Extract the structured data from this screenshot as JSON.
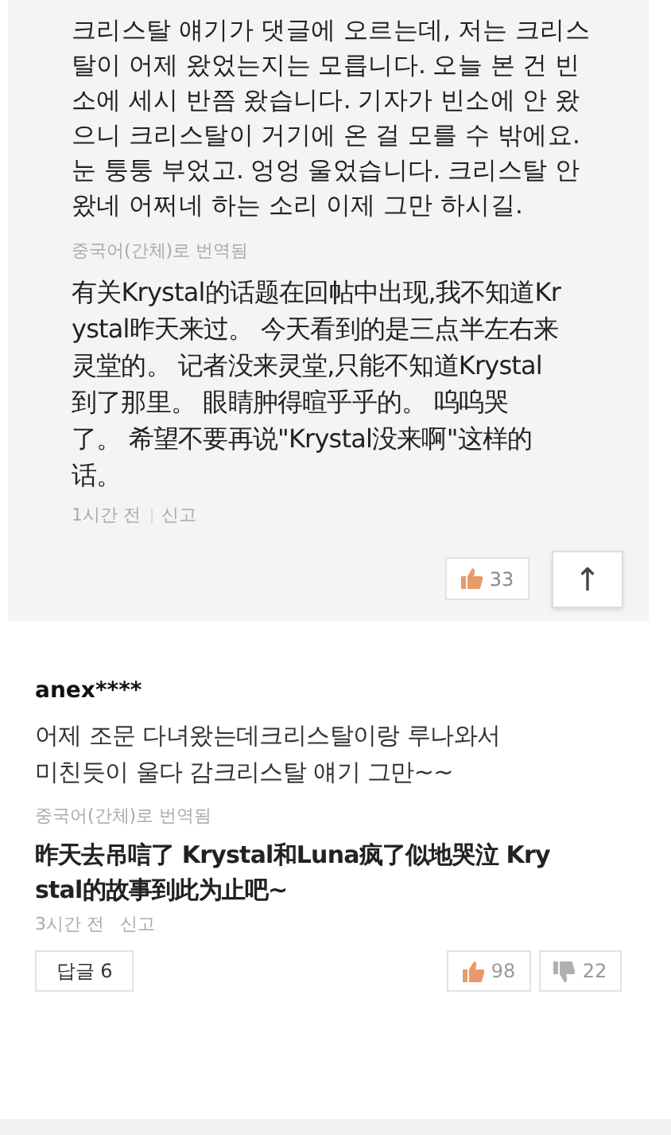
{
  "comments": [
    {
      "original_lines": [
        "크리스탈 얘기가 댓글에 오르는데, 저는 크리스",
        "탈이 어제 왔었는지는 모릅니다. 오늘 본 건 빈",
        "소에 세시 반쯤 왔습니다. 기자가 빈소에 안 왔",
        "으니 크리스탈이 거기에 온 걸 모를 수 밖에요.",
        "눈 퉁퉁 부었고. 엉엉 울었습니다. 크리스탈 안",
        "왔네 어쩌네 하는 소리 이제 그만 하시길."
      ],
      "translation_note": "중국어(간체)로 번역됨",
      "translation_lines": [
        "有关Krystal的话题在回帖中出现,我不知道Kr",
        "ystal昨天来过。 今天看到的是三点半左右来",
        "灵堂的。 记者没来灵堂,只能不知道Krystal",
        "到了那里。 眼睛肿得暄乎乎的。 呜呜哭",
        "了。 希望不要再说\"Krystal没来啊\"这样的",
        "话。"
      ],
      "time": "1시간 전",
      "report": "신고",
      "likes": "33",
      "scroll_top": "↑"
    },
    {
      "user": "anex****",
      "original_lines": [
        "어제 조문 다녀왔는데크리스탈이랑 루나와서",
        "미친듯이 울다 감크리스탈 얘기 그만~~"
      ],
      "translation_note": "중국어(간체)로 번역됨",
      "translation_lines": [
        "昨天去吊唁了 Krystal和Luna疯了似地哭泣 Kry",
        "stal的故事到此为止吧~"
      ],
      "time": "3시간 전",
      "report": "신고",
      "replies": "답글 6",
      "likes": "98",
      "dislikes": "22"
    }
  ]
}
